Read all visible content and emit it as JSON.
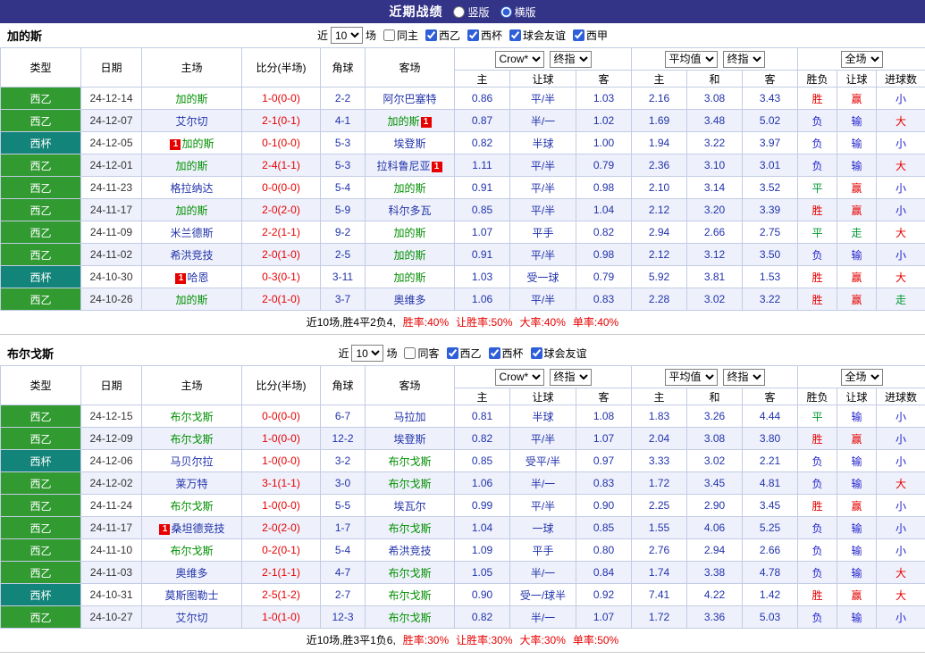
{
  "topbar": {
    "title": "近期战绩",
    "layout_options": [
      {
        "label": "竖版",
        "selected": false
      },
      {
        "label": "横版",
        "selected": true
      }
    ]
  },
  "header": {
    "static_cols": [
      "类型",
      "日期",
      "主场",
      "比分(半场)",
      "角球",
      "客场"
    ],
    "group1_selects": [
      "Crow*",
      "终指"
    ],
    "group1_sub": [
      "主",
      "让球",
      "客"
    ],
    "group2_selects": [
      "平均值",
      "终指"
    ],
    "group2_sub": [
      "主",
      "和",
      "客"
    ],
    "group3_select": "全场",
    "group3_sub": [
      "胜负",
      "让球",
      "进球数"
    ]
  },
  "colors": {
    "topbar_bg": "#333388",
    "league_green": "#319a31",
    "league_cup_teal": "#13847a",
    "focus_team_green": "#008f00",
    "team_link_blue": "#2233aa",
    "score_red": "#e60000",
    "result_win_red": "#e60000",
    "result_lose_blue": "#2222cc",
    "result_draw_green": "#009933",
    "red_card_badge": "#e60000",
    "alt_row_bg": "#eef1fb",
    "table_border": "#c3cce6",
    "checkbox_blue": "#2e5fd9"
  },
  "sections": [
    {
      "team": "加的斯",
      "filter": {
        "near_label": "近",
        "count": "10",
        "games_label": "场",
        "checkboxes": [
          {
            "label": "同主",
            "checked": false
          },
          {
            "label": "西乙",
            "checked": true
          },
          {
            "label": "西杯",
            "checked": true
          },
          {
            "label": "球会友谊",
            "checked": true
          },
          {
            "label": "西甲",
            "checked": true
          }
        ]
      },
      "rows": [
        {
          "league": "西乙",
          "style": "green",
          "date": "24-12-14",
          "home": {
            "name": "加的斯",
            "focus": true
          },
          "score": "1-0(0-0)",
          "corners": "2-2",
          "away": {
            "name": "阿尔巴塞特",
            "focus": false
          },
          "odds": [
            "0.86",
            "平/半",
            "1.03"
          ],
          "avg": [
            "2.16",
            "3.08",
            "3.43"
          ],
          "results": [
            [
              "胜",
              "red"
            ],
            [
              "赢",
              "red"
            ],
            [
              "小",
              "blue"
            ]
          ]
        },
        {
          "league": "西乙",
          "style": "green",
          "date": "24-12-07",
          "home": {
            "name": "艾尔切",
            "focus": false
          },
          "score": "2-1(0-1)",
          "corners": "4-1",
          "away": {
            "name": "加的斯",
            "focus": true,
            "card": "1",
            "card_pos": "after"
          },
          "odds": [
            "0.87",
            "半/一",
            "1.02"
          ],
          "avg": [
            "1.69",
            "3.48",
            "5.02"
          ],
          "results": [
            [
              "负",
              "blue"
            ],
            [
              "输",
              "blue"
            ],
            [
              "大",
              "red"
            ]
          ]
        },
        {
          "league": "西杯",
          "style": "teal",
          "date": "24-12-05",
          "home": {
            "name": "加的斯",
            "focus": true,
            "card": "1",
            "card_pos": "before"
          },
          "score": "0-1(0-0)",
          "corners": "5-3",
          "away": {
            "name": "埃登斯",
            "focus": false
          },
          "odds": [
            "0.82",
            "半球",
            "1.00"
          ],
          "avg": [
            "1.94",
            "3.22",
            "3.97"
          ],
          "results": [
            [
              "负",
              "blue"
            ],
            [
              "输",
              "blue"
            ],
            [
              "小",
              "blue"
            ]
          ]
        },
        {
          "league": "西乙",
          "style": "green",
          "date": "24-12-01",
          "home": {
            "name": "加的斯",
            "focus": true
          },
          "score": "2-4(1-1)",
          "corners": "5-3",
          "away": {
            "name": "拉科鲁尼亚",
            "focus": false,
            "card": "1",
            "card_pos": "after"
          },
          "odds": [
            "1.11",
            "平/半",
            "0.79"
          ],
          "avg": [
            "2.36",
            "3.10",
            "3.01"
          ],
          "results": [
            [
              "负",
              "blue"
            ],
            [
              "输",
              "blue"
            ],
            [
              "大",
              "red"
            ]
          ]
        },
        {
          "league": "西乙",
          "style": "green",
          "date": "24-11-23",
          "home": {
            "name": "格拉纳达",
            "focus": false
          },
          "score": "0-0(0-0)",
          "corners": "5-4",
          "away": {
            "name": "加的斯",
            "focus": true
          },
          "odds": [
            "0.91",
            "平/半",
            "0.98"
          ],
          "avg": [
            "2.10",
            "3.14",
            "3.52"
          ],
          "results": [
            [
              "平",
              "green"
            ],
            [
              "赢",
              "red"
            ],
            [
              "小",
              "blue"
            ]
          ]
        },
        {
          "league": "西乙",
          "style": "green",
          "date": "24-11-17",
          "home": {
            "name": "加的斯",
            "focus": true
          },
          "score": "2-0(2-0)",
          "corners": "5-9",
          "away": {
            "name": "科尔多瓦",
            "focus": false
          },
          "odds": [
            "0.85",
            "平/半",
            "1.04"
          ],
          "avg": [
            "2.12",
            "3.20",
            "3.39"
          ],
          "results": [
            [
              "胜",
              "red"
            ],
            [
              "赢",
              "red"
            ],
            [
              "小",
              "blue"
            ]
          ]
        },
        {
          "league": "西乙",
          "style": "green",
          "date": "24-11-09",
          "home": {
            "name": "米兰德斯",
            "focus": false
          },
          "score": "2-2(1-1)",
          "corners": "9-2",
          "away": {
            "name": "加的斯",
            "focus": true
          },
          "odds": [
            "1.07",
            "平手",
            "0.82"
          ],
          "avg": [
            "2.94",
            "2.66",
            "2.75"
          ],
          "results": [
            [
              "平",
              "green"
            ],
            [
              "走",
              "green"
            ],
            [
              "大",
              "red"
            ]
          ]
        },
        {
          "league": "西乙",
          "style": "green",
          "date": "24-11-02",
          "home": {
            "name": "希洪竞技",
            "focus": false
          },
          "score": "2-0(1-0)",
          "corners": "2-5",
          "away": {
            "name": "加的斯",
            "focus": true
          },
          "odds": [
            "0.91",
            "平/半",
            "0.98"
          ],
          "avg": [
            "2.12",
            "3.12",
            "3.50"
          ],
          "results": [
            [
              "负",
              "blue"
            ],
            [
              "输",
              "blue"
            ],
            [
              "小",
              "blue"
            ]
          ]
        },
        {
          "league": "西杯",
          "style": "teal",
          "date": "24-10-30",
          "home": {
            "name": "哈恩",
            "focus": false,
            "card": "1",
            "card_pos": "before"
          },
          "score": "0-3(0-1)",
          "corners": "3-11",
          "away": {
            "name": "加的斯",
            "focus": true
          },
          "odds": [
            "1.03",
            "受一球",
            "0.79"
          ],
          "avg": [
            "5.92",
            "3.81",
            "1.53"
          ],
          "results": [
            [
              "胜",
              "red"
            ],
            [
              "赢",
              "red"
            ],
            [
              "大",
              "red"
            ]
          ]
        },
        {
          "league": "西乙",
          "style": "green",
          "date": "24-10-26",
          "home": {
            "name": "加的斯",
            "focus": true
          },
          "score": "2-0(1-0)",
          "corners": "3-7",
          "away": {
            "name": "奥维多",
            "focus": false
          },
          "odds": [
            "1.06",
            "平/半",
            "0.83"
          ],
          "avg": [
            "2.28",
            "3.02",
            "3.22"
          ],
          "results": [
            [
              "胜",
              "red"
            ],
            [
              "赢",
              "red"
            ],
            [
              "走",
              "green"
            ]
          ]
        }
      ],
      "summary": {
        "prefix": "近10场,胜4平2负4,",
        "stats": [
          "胜率:40%",
          "让胜率:50%",
          "大率:40%",
          "单率:40%"
        ]
      }
    },
    {
      "team": "布尔戈斯",
      "filter": {
        "near_label": "近",
        "count": "10",
        "games_label": "场",
        "checkboxes": [
          {
            "label": "同客",
            "checked": false
          },
          {
            "label": "西乙",
            "checked": true
          },
          {
            "label": "西杯",
            "checked": true
          },
          {
            "label": "球会友谊",
            "checked": true
          }
        ]
      },
      "rows": [
        {
          "league": "西乙",
          "style": "green",
          "date": "24-12-15",
          "home": {
            "name": "布尔戈斯",
            "focus": true
          },
          "score": "0-0(0-0)",
          "corners": "6-7",
          "away": {
            "name": "马拉加",
            "focus": false
          },
          "odds": [
            "0.81",
            "半球",
            "1.08"
          ],
          "avg": [
            "1.83",
            "3.26",
            "4.44"
          ],
          "results": [
            [
              "平",
              "green"
            ],
            [
              "输",
              "blue"
            ],
            [
              "小",
              "blue"
            ]
          ]
        },
        {
          "league": "西乙",
          "style": "green",
          "date": "24-12-09",
          "home": {
            "name": "布尔戈斯",
            "focus": true
          },
          "score": "1-0(0-0)",
          "corners": "12-2",
          "away": {
            "name": "埃登斯",
            "focus": false
          },
          "odds": [
            "0.82",
            "平/半",
            "1.07"
          ],
          "avg": [
            "2.04",
            "3.08",
            "3.80"
          ],
          "results": [
            [
              "胜",
              "red"
            ],
            [
              "赢",
              "red"
            ],
            [
              "小",
              "blue"
            ]
          ]
        },
        {
          "league": "西杯",
          "style": "teal",
          "date": "24-12-06",
          "home": {
            "name": "马贝尔拉",
            "focus": false
          },
          "score": "1-0(0-0)",
          "corners": "3-2",
          "away": {
            "name": "布尔戈斯",
            "focus": true
          },
          "odds": [
            "0.85",
            "受平/半",
            "0.97"
          ],
          "avg": [
            "3.33",
            "3.02",
            "2.21"
          ],
          "results": [
            [
              "负",
              "blue"
            ],
            [
              "输",
              "blue"
            ],
            [
              "小",
              "blue"
            ]
          ]
        },
        {
          "league": "西乙",
          "style": "green",
          "date": "24-12-02",
          "home": {
            "name": "莱万特",
            "focus": false
          },
          "score": "3-1(1-1)",
          "corners": "3-0",
          "away": {
            "name": "布尔戈斯",
            "focus": true
          },
          "odds": [
            "1.06",
            "半/一",
            "0.83"
          ],
          "avg": [
            "1.72",
            "3.45",
            "4.81"
          ],
          "results": [
            [
              "负",
              "blue"
            ],
            [
              "输",
              "blue"
            ],
            [
              "大",
              "red"
            ]
          ]
        },
        {
          "league": "西乙",
          "style": "green",
          "date": "24-11-24",
          "home": {
            "name": "布尔戈斯",
            "focus": true
          },
          "score": "1-0(0-0)",
          "corners": "5-5",
          "away": {
            "name": "埃瓦尔",
            "focus": false
          },
          "odds": [
            "0.99",
            "平/半",
            "0.90"
          ],
          "avg": [
            "2.25",
            "2.90",
            "3.45"
          ],
          "results": [
            [
              "胜",
              "red"
            ],
            [
              "赢",
              "red"
            ],
            [
              "小",
              "blue"
            ]
          ]
        },
        {
          "league": "西乙",
          "style": "green",
          "date": "24-11-17",
          "home": {
            "name": "桑坦德竞技",
            "focus": false,
            "card": "1",
            "card_pos": "before"
          },
          "score": "2-0(2-0)",
          "corners": "1-7",
          "away": {
            "name": "布尔戈斯",
            "focus": true
          },
          "odds": [
            "1.04",
            "一球",
            "0.85"
          ],
          "avg": [
            "1.55",
            "4.06",
            "5.25"
          ],
          "results": [
            [
              "负",
              "blue"
            ],
            [
              "输",
              "blue"
            ],
            [
              "小",
              "blue"
            ]
          ]
        },
        {
          "league": "西乙",
          "style": "green",
          "date": "24-11-10",
          "home": {
            "name": "布尔戈斯",
            "focus": true
          },
          "score": "0-2(0-1)",
          "corners": "5-4",
          "away": {
            "name": "希洪竞技",
            "focus": false
          },
          "odds": [
            "1.09",
            "平手",
            "0.80"
          ],
          "avg": [
            "2.76",
            "2.94",
            "2.66"
          ],
          "results": [
            [
              "负",
              "blue"
            ],
            [
              "输",
              "blue"
            ],
            [
              "小",
              "blue"
            ]
          ]
        },
        {
          "league": "西乙",
          "style": "green",
          "date": "24-11-03",
          "home": {
            "name": "奥维多",
            "focus": false
          },
          "score": "2-1(1-1)",
          "corners": "4-7",
          "away": {
            "name": "布尔戈斯",
            "focus": true
          },
          "odds": [
            "1.05",
            "半/一",
            "0.84"
          ],
          "avg": [
            "1.74",
            "3.38",
            "4.78"
          ],
          "results": [
            [
              "负",
              "blue"
            ],
            [
              "输",
              "blue"
            ],
            [
              "大",
              "red"
            ]
          ]
        },
        {
          "league": "西杯",
          "style": "teal",
          "date": "24-10-31",
          "home": {
            "name": "莫斯图勒士",
            "focus": false
          },
          "score": "2-5(1-2)",
          "corners": "2-7",
          "away": {
            "name": "布尔戈斯",
            "focus": true
          },
          "odds": [
            "0.90",
            "受一/球半",
            "0.92"
          ],
          "avg": [
            "7.41",
            "4.22",
            "1.42"
          ],
          "results": [
            [
              "胜",
              "red"
            ],
            [
              "赢",
              "red"
            ],
            [
              "大",
              "red"
            ]
          ]
        },
        {
          "league": "西乙",
          "style": "green",
          "date": "24-10-27",
          "home": {
            "name": "艾尔切",
            "focus": false
          },
          "score": "1-0(1-0)",
          "corners": "12-3",
          "away": {
            "name": "布尔戈斯",
            "focus": true
          },
          "odds": [
            "0.82",
            "半/一",
            "1.07"
          ],
          "avg": [
            "1.72",
            "3.36",
            "5.03"
          ],
          "results": [
            [
              "负",
              "blue"
            ],
            [
              "输",
              "blue"
            ],
            [
              "小",
              "blue"
            ]
          ]
        }
      ],
      "summary": {
        "prefix": "近10场,胜3平1负6,",
        "stats": [
          "胜率:30%",
          "让胜率:30%",
          "大率:30%",
          "单率:50%"
        ]
      }
    }
  ]
}
